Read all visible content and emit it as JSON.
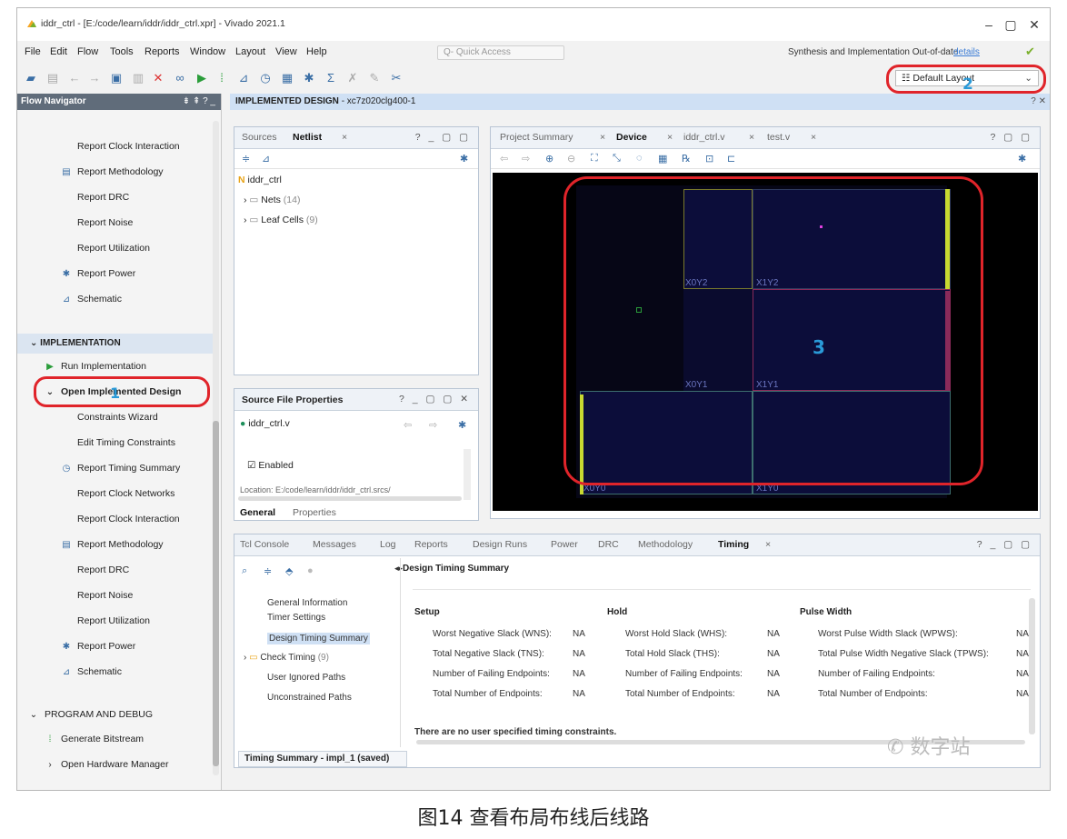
{
  "window": {
    "title": "iddr_ctrl - [E:/code/learn/iddr/iddr_ctrl.xpr] - Vivado 2021.1",
    "controls": [
      "–",
      "▢",
      "✕"
    ]
  },
  "menu": {
    "items": [
      "File",
      "Edit",
      "Flow",
      "Tools",
      "Reports",
      "Window",
      "Layout",
      "View",
      "Help"
    ],
    "quick_access_placeholder": "Q- Quick Access",
    "status_text": "Synthesis and Implementation Out-of-date",
    "details_link": "details"
  },
  "toolbar": {
    "layout_select": "Default Layout",
    "layout_callout_number": "2"
  },
  "flow_navigator": {
    "header": "Flow Navigator",
    "header_controls": "⇟ ⇞ ? _",
    "top_items": [
      {
        "label": "Report Clock Interaction",
        "icon": ""
      },
      {
        "label": "Report Methodology",
        "icon": "clipboard-icon"
      },
      {
        "label": "Report DRC",
        "icon": ""
      },
      {
        "label": "Report Noise",
        "icon": ""
      },
      {
        "label": "Report Utilization",
        "icon": ""
      },
      {
        "label": "Report Power",
        "icon": "power-icon"
      },
      {
        "label": "Schematic",
        "icon": "schematic-icon"
      }
    ],
    "implementation_section": "IMPLEMENTATION",
    "run_implementation": "Run Implementation",
    "open_implemented_design": "Open Implemented Design",
    "callout_number": "1",
    "impl_items": [
      {
        "label": "Constraints Wizard",
        "icon": ""
      },
      {
        "label": "Edit Timing Constraints",
        "icon": ""
      },
      {
        "label": "Report Timing Summary",
        "icon": "timer-icon"
      },
      {
        "label": "Report Clock Networks",
        "icon": ""
      },
      {
        "label": "Report Clock Interaction",
        "icon": ""
      },
      {
        "label": "Report Methodology",
        "icon": "clipboard-icon"
      },
      {
        "label": "Report DRC",
        "icon": ""
      },
      {
        "label": "Report Noise",
        "icon": ""
      },
      {
        "label": "Report Utilization",
        "icon": ""
      },
      {
        "label": "Report Power",
        "icon": "power-icon"
      },
      {
        "label": "Schematic",
        "icon": "schematic-icon"
      }
    ],
    "program_section": "PROGRAM AND DEBUG",
    "generate_bitstream": "Generate Bitstream",
    "open_hardware_manager": "Open Hardware Manager"
  },
  "implemented_design_bar": {
    "label": "IMPLEMENTED DESIGN",
    "part": "- xc7z020clg400-1",
    "controls": "? ✕"
  },
  "netlist_panel": {
    "tabs": [
      "Sources",
      "Netlist"
    ],
    "active_tab": "Netlist",
    "controls": "? _ ▢ ▢",
    "root": "iddr_ctrl",
    "nets": "Nets",
    "nets_count": "(14)",
    "leaf_cells": "Leaf Cells",
    "leaf_cells_count": "(9)"
  },
  "source_props": {
    "title": "Source File Properties",
    "controls": "? _ ▢ ▢ ✕",
    "file": "iddr_ctrl.v",
    "enabled": "Enabled",
    "location": "Location:",
    "location_value": "E:/code/learn/iddr/iddr_ctrl.srcs/",
    "tabs": [
      "General",
      "Properties"
    ]
  },
  "device_panel": {
    "tabs": [
      "Project Summary",
      "Device",
      "iddr_ctrl.v",
      "test.v"
    ],
    "active_tab": "Device",
    "controls": "? ▢ ▢",
    "clock_regions": [
      "X0Y2",
      "X1Y2",
      "X0Y1",
      "X1Y1",
      "X0Y0",
      "X1Y0"
    ],
    "callout_number": "3"
  },
  "bottom_panel": {
    "tabs": [
      "Tcl Console",
      "Messages",
      "Log",
      "Reports",
      "Design Runs",
      "Power",
      "DRC",
      "Methodology",
      "Timing"
    ],
    "active_tab": "Timing",
    "controls": "? _ ▢ ▢",
    "tree": [
      "General Information",
      "Timer Settings",
      "Design Timing Summary",
      "Check Timing",
      "User Ignored Paths",
      "Unconstrained Paths"
    ],
    "check_timing_count": "(9)",
    "title": "Design Timing Summary",
    "setup": {
      "heading": "Setup",
      "rows": [
        {
          "label": "Worst Negative Slack (WNS):",
          "value": "NA"
        },
        {
          "label": "Total Negative Slack (TNS):",
          "value": "NA"
        },
        {
          "label": "Number of Failing Endpoints:",
          "value": "NA"
        },
        {
          "label": "Total Number of Endpoints:",
          "value": "NA"
        }
      ]
    },
    "hold": {
      "heading": "Hold",
      "rows": [
        {
          "label": "Worst Hold Slack (WHS):",
          "value": "NA"
        },
        {
          "label": "Total Hold Slack (THS):",
          "value": "NA"
        },
        {
          "label": "Number of Failing Endpoints:",
          "value": "NA"
        },
        {
          "label": "Total Number of Endpoints:",
          "value": "NA"
        }
      ]
    },
    "pulse": {
      "heading": "Pulse Width",
      "rows": [
        {
          "label": "Worst Pulse Width Slack (WPWS):",
          "value": "NA"
        },
        {
          "label": "Total Pulse Width Negative Slack (TPWS):",
          "value": "NA"
        },
        {
          "label": "Number of Failing Endpoints:",
          "value": "NA"
        },
        {
          "label": "Total Number of Endpoints:",
          "value": "NA"
        }
      ]
    },
    "no_constraints": "There are no user specified timing constraints.",
    "footer_tab": "Timing Summary - impl_1 (saved)"
  },
  "caption": "图14 查看布局布线后线路",
  "watermark": "数字站",
  "colors": {
    "callout": "#e0242a",
    "callout_number": "#2a9ad8",
    "section_bg": "#dbe5f1",
    "device_bg": "#000000"
  }
}
